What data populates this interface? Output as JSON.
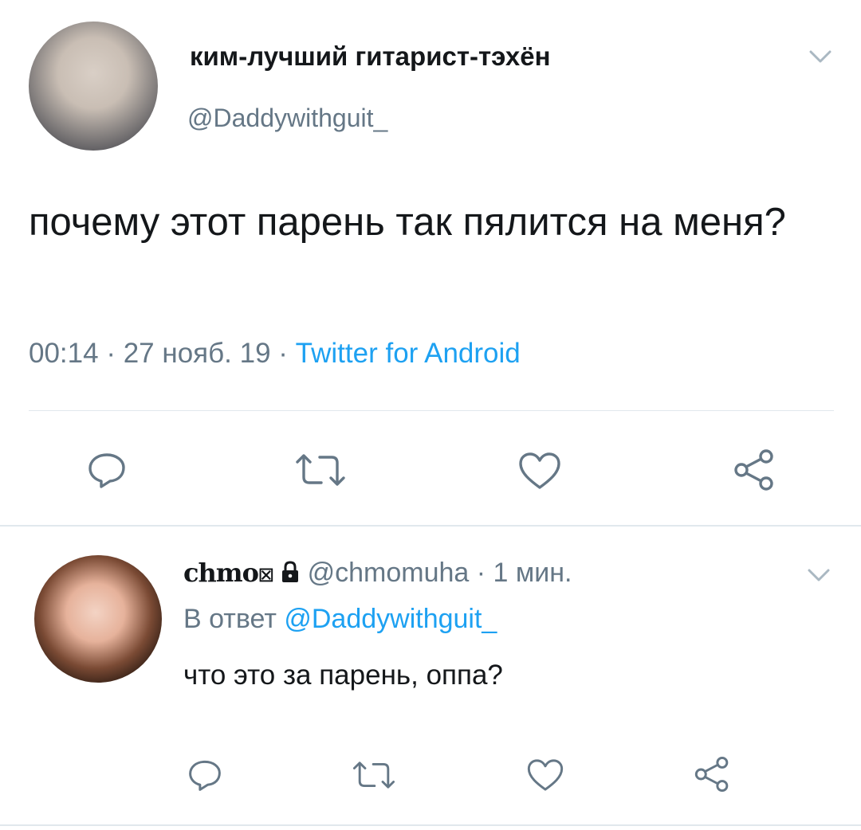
{
  "main_tweet": {
    "display_name": "ким-лучший гитарист-тэхён",
    "handle": "@Daddywithguit_",
    "text": "почему этот парень так пялится на меня?",
    "time": "00:14",
    "date": "27 нояб. 19",
    "separator": "·",
    "source": "Twitter for Android",
    "menu_icon": "chevron-down-icon",
    "actions": [
      "reply-icon",
      "retweet-icon",
      "like-icon",
      "share-icon"
    ]
  },
  "reply_tweet": {
    "display_name": "chmo",
    "name_glyph": "☒",
    "lock_icon": "lock-icon",
    "handle": "@chmomuha",
    "separator": "·",
    "time_ago": "1 мин.",
    "in_reply_prefix": "В ответ",
    "in_reply_mention": "@Daddywithguit_",
    "text": "что это за парень, оппа?",
    "menu_icon": "chevron-down-icon",
    "actions": [
      "reply-icon",
      "retweet-icon",
      "like-icon",
      "share-icon"
    ]
  },
  "colors": {
    "accent": "#1da1f2",
    "text": "#14171a",
    "secondary": "#657786",
    "divider": "#e1e8ed",
    "icon": "#657786"
  }
}
